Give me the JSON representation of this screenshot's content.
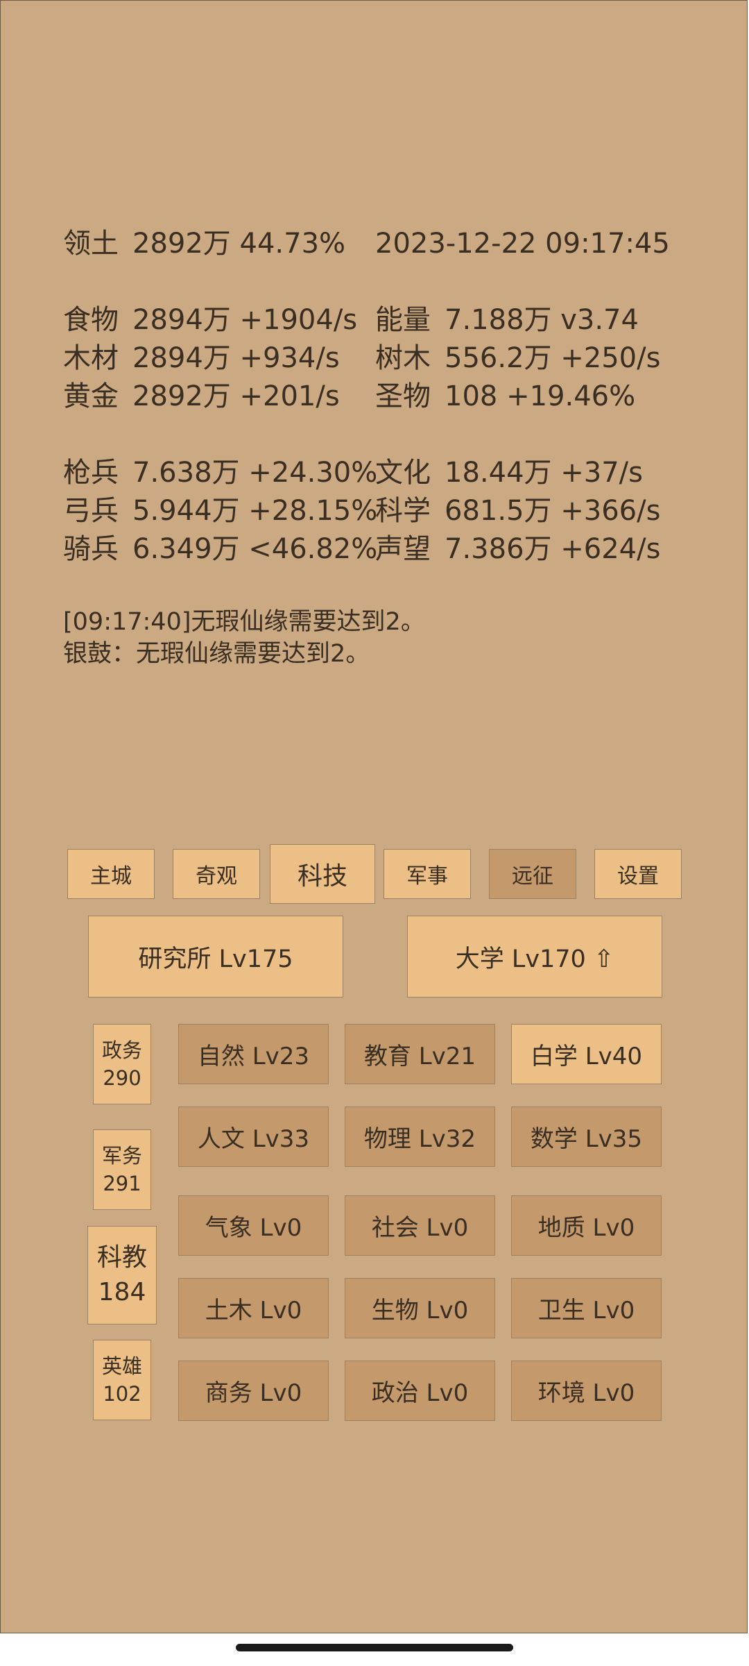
{
  "header": {
    "territory_label": "领土",
    "territory_value": "2892万  44.73%",
    "datetime": "2023-12-22 09:17:45"
  },
  "resources_left": [
    {
      "label": "食物",
      "value": "2894万 +1904/s"
    },
    {
      "label": "木材",
      "value": "2894万 +934/s"
    },
    {
      "label": "黄金",
      "value": "2892万 +201/s"
    }
  ],
  "resources_right": [
    {
      "label": "能量",
      "value": "7.188万  v3.74"
    },
    {
      "label": "树木",
      "value": "556.2万 +250/s"
    },
    {
      "label": "圣物",
      "value": "108 +19.46%"
    }
  ],
  "military_left": [
    {
      "label": "枪兵",
      "value": "7.638万 +24.30%"
    },
    {
      "label": "弓兵",
      "value": "5.944万 +28.15%"
    },
    {
      "label": "骑兵",
      "value": "6.349万 <46.82%"
    }
  ],
  "military_right": [
    {
      "label": "文化",
      "value": "18.44万 +37/s"
    },
    {
      "label": "科学",
      "value": "681.5万 +366/s"
    },
    {
      "label": "声望",
      "value": "7.386万 +624/s"
    }
  ],
  "messages": [
    "[09:17:40]无瑕仙缘需要达到2。",
    "银鼓：无瑕仙缘需要达到2。"
  ],
  "tabs": [
    "主城",
    "奇观",
    "科技",
    "军事",
    "远征",
    "设置"
  ],
  "buildings": {
    "research": "研究所 Lv175",
    "university": "大学 Lv170 ⇧"
  },
  "sidebar": [
    {
      "name": "政务",
      "count": "290"
    },
    {
      "name": "军务",
      "count": "291"
    },
    {
      "name": "科教",
      "count": "184"
    },
    {
      "name": "英雄",
      "count": "102"
    }
  ],
  "subjects": [
    [
      "自然 Lv23",
      "教育 Lv21",
      "白学 Lv40"
    ],
    [
      "人文 Lv33",
      "物理 Lv32",
      "数学 Lv35"
    ],
    [
      "气象 Lv0",
      "社会 Lv0",
      "地质 Lv0"
    ],
    [
      "土木 Lv0",
      "生物 Lv0",
      "卫生 Lv0"
    ],
    [
      "商务 Lv0",
      "政治 Lv0",
      "环境 Lv0"
    ]
  ],
  "colors": {
    "background": "#cba982",
    "button_light": "#ebbf86",
    "button_dark": "#c49a6c",
    "text": "#3a2e22"
  }
}
